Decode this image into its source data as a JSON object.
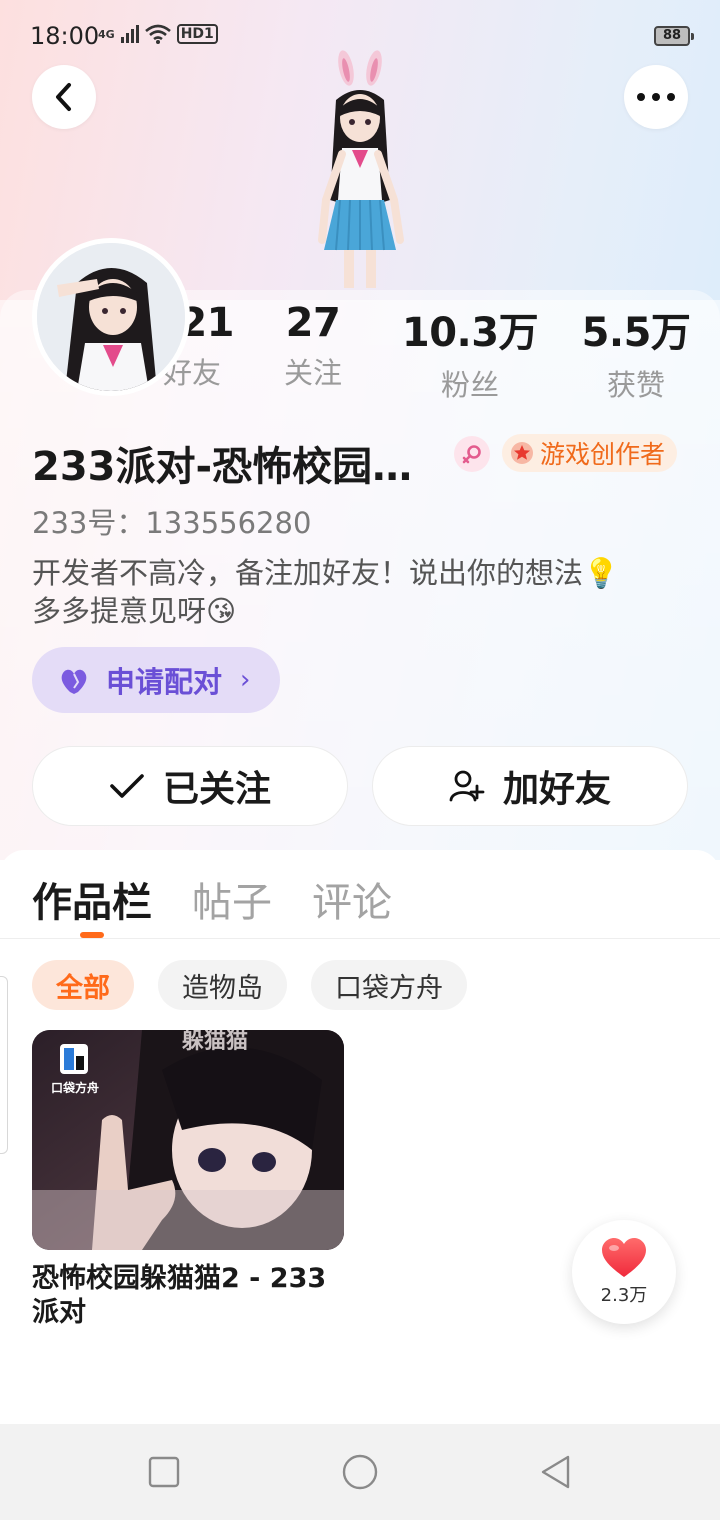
{
  "status_bar": {
    "time": "18:00",
    "network": "4G",
    "hd": "HD1",
    "battery": "88"
  },
  "header": {
    "back_icon": "chevron-left-icon",
    "more_icon": "more-dots-icon"
  },
  "profile": {
    "stats": [
      {
        "value": "621",
        "label": "好友"
      },
      {
        "value": "27",
        "label": "关注"
      },
      {
        "value": "10.3万",
        "label": "粉丝"
      },
      {
        "value": "5.5万",
        "label": "获赞"
      }
    ],
    "name": "233派对-恐怖校园…",
    "gender_icon": "female-symbol-icon",
    "creator_badge": "游戏创作者",
    "uid": "233号：133556280",
    "bio_line1": "开发者不高冷，备注加好友！说出你的想法💡",
    "bio_line2": "多多提意见呀😘",
    "pair_button": "申请配对",
    "follow_button": "已关注",
    "add_friend_button": "加好友"
  },
  "tabs": [
    "作品栏",
    "帖子",
    "评论"
  ],
  "active_tab": 0,
  "filters": [
    "全部",
    "造物岛",
    "口袋方舟"
  ],
  "active_filter": 0,
  "works": [
    {
      "title": "恐怖校园躲猫猫2 - 233派对",
      "thumb_badge": "口袋方舟"
    }
  ],
  "like_fab": {
    "count": "2.3万"
  },
  "colors": {
    "accent": "#ff6a1a",
    "pair_purple": "#6a4fd6",
    "muted_text": "#9a9a9a"
  }
}
